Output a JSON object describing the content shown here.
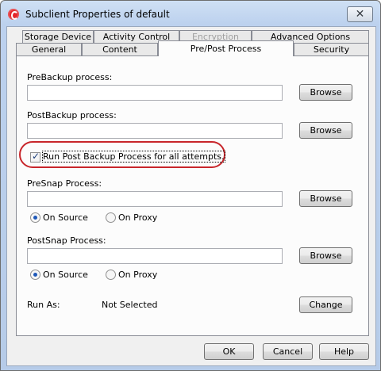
{
  "window": {
    "title": "Subclient Properties of default",
    "close_glyph": "✕"
  },
  "tabs": {
    "row1": [
      {
        "label": "Storage Device",
        "disabled": false
      },
      {
        "label": "Activity Control",
        "disabled": false
      },
      {
        "label": "Encryption",
        "disabled": true
      },
      {
        "label": "Advanced Options",
        "disabled": false
      }
    ],
    "row2": [
      {
        "label": "General"
      },
      {
        "label": "Content"
      },
      {
        "label": "Pre/Post Process",
        "active": true
      },
      {
        "label": "Security"
      }
    ]
  },
  "form": {
    "prebackup_label": "PreBackup process:",
    "prebackup_value": "",
    "postbackup_label": "PostBackup process:",
    "postbackup_value": "",
    "browse_label": "Browse",
    "run_post_all_label": "Run Post Backup Process for all attempts.",
    "run_post_all_checked": true,
    "presnap_label": "PreSnap Process:",
    "presnap_value": "",
    "postsnap_label": "PostSnap Process:",
    "postsnap_value": "",
    "on_source_label": "On Source",
    "on_proxy_label": "On Proxy",
    "presnap_selected": "On Source",
    "postsnap_selected": "On Source",
    "run_as_label": "Run As:",
    "run_as_value": "Not Selected",
    "change_label": "Change"
  },
  "footer": {
    "ok_label": "OK",
    "cancel_label": "Cancel",
    "help_label": "Help"
  },
  "colors": {
    "highlight_ring": "#c8262b",
    "app_icon": "#e3262b"
  }
}
